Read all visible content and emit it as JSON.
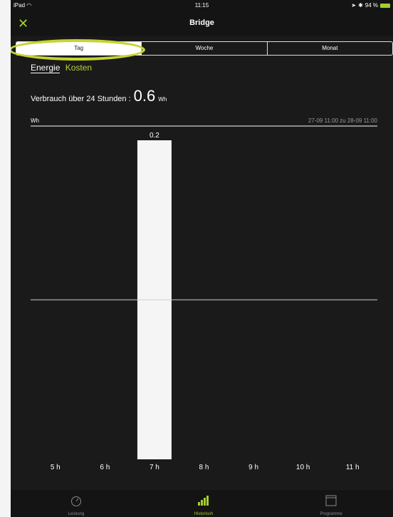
{
  "status_bar": {
    "device": "iPad",
    "time": "11:15",
    "battery_text": "94 %"
  },
  "nav": {
    "title": "Bridge",
    "close_icon": "close-icon"
  },
  "segments": [
    {
      "label": "Tag",
      "active": true
    },
    {
      "label": "Woche",
      "active": false
    },
    {
      "label": "Monat",
      "active": false
    }
  ],
  "metric_tabs": {
    "active": "Energie",
    "inactive": "Kosten"
  },
  "usage": {
    "label": "Verbrauch über 24 Stunden :",
    "value": "0.6",
    "unit": "Wh"
  },
  "chart_data": {
    "type": "bar",
    "ylabel": "Wh",
    "date_range": "27-09 11:00 zu 28-09 11:00",
    "categories": [
      "5 h",
      "6 h",
      "7 h",
      "8 h",
      "9 h",
      "10 h",
      "11 h"
    ],
    "values": [
      0,
      0,
      0.2,
      0,
      0,
      0,
      0
    ],
    "data_labels": [
      "",
      "",
      "0.2",
      "",
      "",
      "",
      ""
    ],
    "ylim": [
      0,
      0.2
    ],
    "gridline_value": 0.1,
    "bar_color": "#f5f5f5"
  },
  "tabbar": [
    {
      "label": "Leistung",
      "icon": "speedometer-icon",
      "active": false
    },
    {
      "label": "Historisch",
      "icon": "bar-chart-icon",
      "active": true
    },
    {
      "label": "Programme",
      "icon": "calendar-icon",
      "active": false
    }
  ],
  "colors": {
    "accent": "#a6cf2f",
    "background": "#1a1a1a",
    "highlight": "#c6d430"
  }
}
